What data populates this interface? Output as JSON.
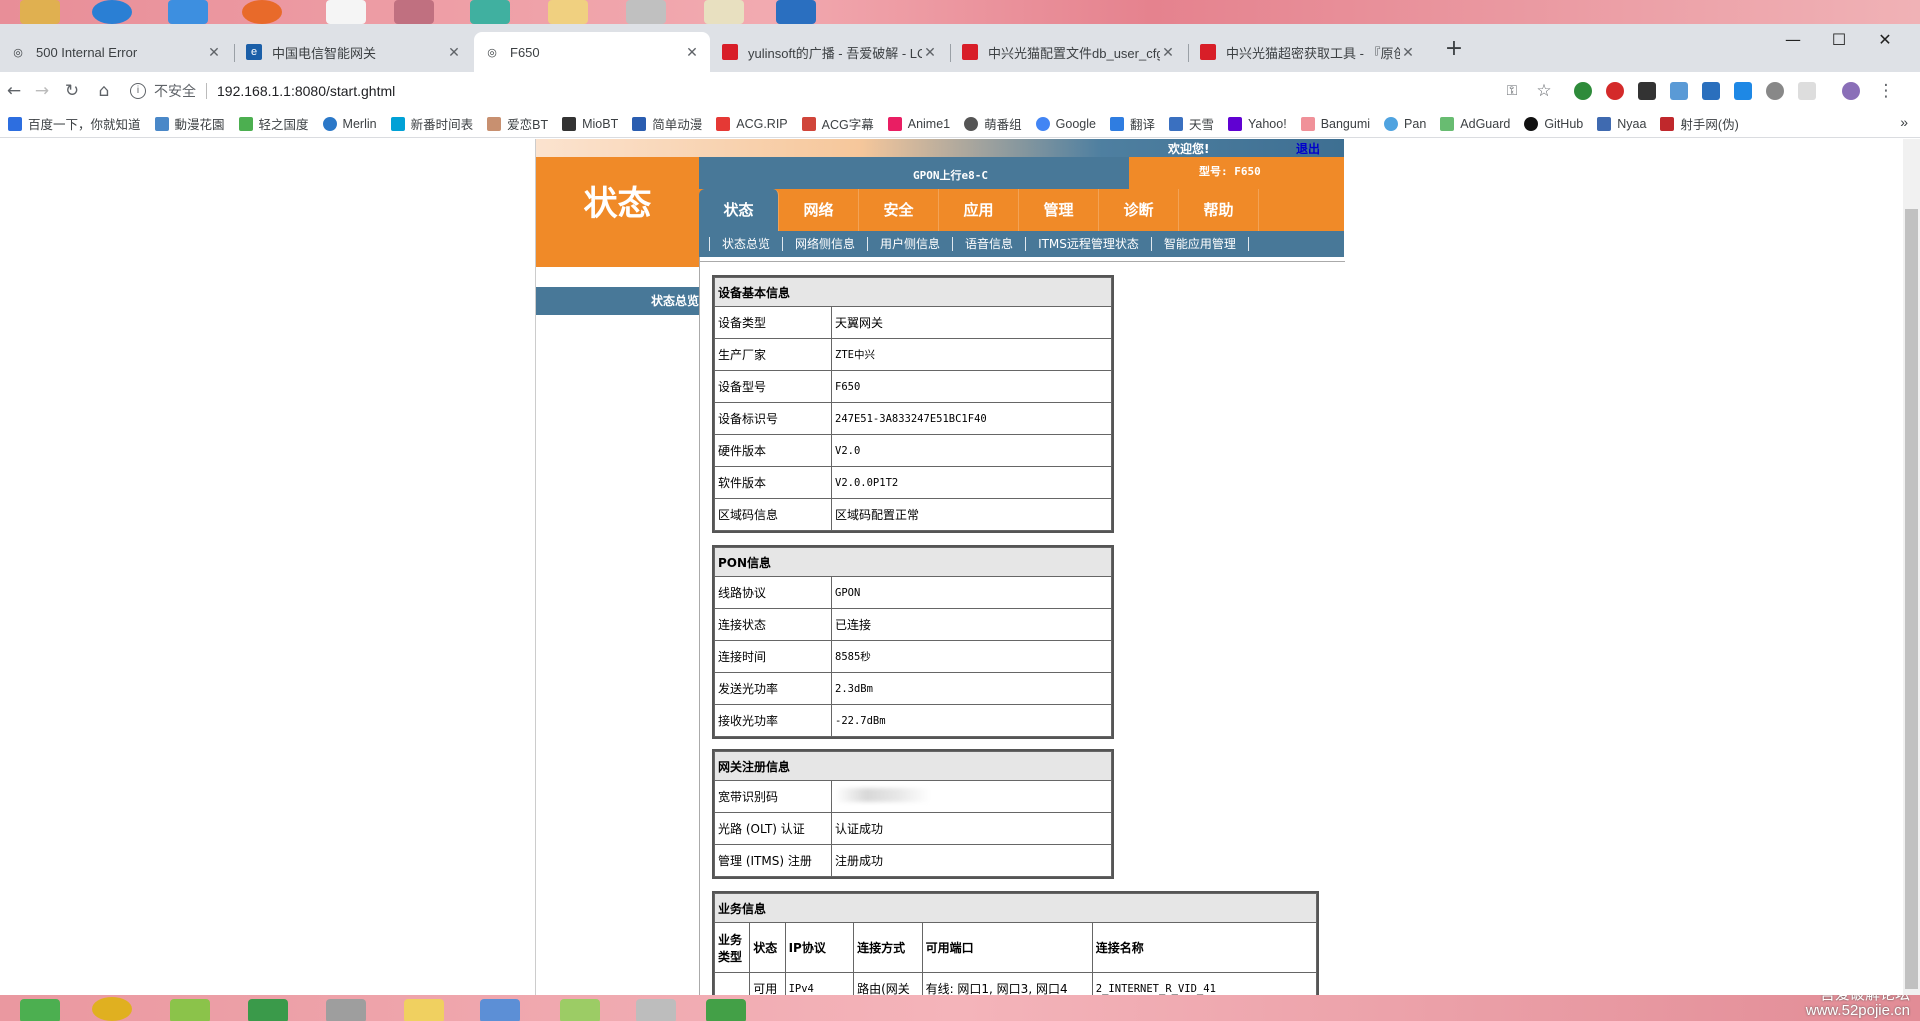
{
  "browser": {
    "tabs": [
      {
        "title": "500 Internal Error",
        "active": false
      },
      {
        "title": "中国电信智能网关",
        "active": false
      },
      {
        "title": "F650",
        "active": true
      },
      {
        "title": "yulinsoft的广播 - 吾爱破解 - LCG",
        "active": false
      },
      {
        "title": "中兴光猫配置文件db_user_cfg.xml",
        "active": false
      },
      {
        "title": "中兴光猫超密获取工具 - 『原创', ",
        "active": false
      }
    ],
    "address": {
      "insecure_label": "不安全",
      "url": "192.168.1.1:8080/start.ghtml"
    },
    "bookmarks": [
      "百度一下，你就知道",
      "動漫花園",
      "轻之国度",
      "Merlin",
      "新番时间表",
      "爱恋BT",
      "MioBT",
      "简单动漫",
      "ACG.RIP",
      "ACG字幕",
      "Anime1",
      "萌番组",
      "Google",
      "翻译",
      "天雪",
      "Yahoo!",
      "Bangumi",
      "Pan",
      "AdGuard",
      "GitHub",
      "Nyaa",
      "射手网(伪)"
    ]
  },
  "router": {
    "welcome": "欢迎您!",
    "logout": "退出",
    "logo_title": "状态",
    "uplink": "GPON上行e8-C",
    "model": "型号: F650",
    "main_nav": [
      "状态",
      "网络",
      "安全",
      "应用",
      "管理",
      "诊断",
      "帮助"
    ],
    "sub_nav": [
      "状态总览",
      "网络侧信息",
      "用户侧信息",
      "语音信息",
      "ITMS远程管理状态",
      "智能应用管理"
    ],
    "left_menu_item": "状态总览",
    "device_info": {
      "title": "设备基本信息",
      "rows": [
        {
          "label": "设备类型",
          "value": "天翼网关"
        },
        {
          "label": "生产厂家",
          "value": "ZTE中兴"
        },
        {
          "label": "设备型号",
          "value": "F650"
        },
        {
          "label": "设备标识号",
          "value": "247E51-3A833247E51BC1F40"
        },
        {
          "label": "硬件版本",
          "value": "V2.0"
        },
        {
          "label": "软件版本",
          "value": "V2.0.0P1T2"
        },
        {
          "label": "区域码信息",
          "value": "区域码配置正常"
        }
      ]
    },
    "pon_info": {
      "title": "PON信息",
      "rows": [
        {
          "label": "线路协议",
          "value": "GPON"
        },
        {
          "label": "连接状态",
          "value": "已连接"
        },
        {
          "label": "连接时间",
          "value": "8585秒"
        },
        {
          "label": "发送光功率",
          "value": "2.3dBm"
        },
        {
          "label": "接收光功率",
          "value": "-22.7dBm"
        }
      ]
    },
    "gw_reg": {
      "title": "网关注册信息",
      "rows": [
        {
          "label": "宽带识别码",
          "value": ""
        },
        {
          "label": "光路 (OLT) 认证",
          "value": "认证成功"
        },
        {
          "label": "管理 (ITMS) 注册",
          "value": "注册成功"
        }
      ]
    },
    "business": {
      "title": "业务信息",
      "headers": [
        "业务类型",
        "状态",
        "IP协议",
        "连接方式",
        "可用端口",
        "连接名称"
      ],
      "partial_row": [
        "",
        "可用",
        "IPv4",
        "路由(网关",
        "有线: 网口1, 网口3, 网口4",
        "2_INTERNET_R_VID_41"
      ]
    }
  },
  "desktop": {
    "watermark_line1": "吾爱破解论坛",
    "watermark_line2": "www.52pojie.cn"
  }
}
